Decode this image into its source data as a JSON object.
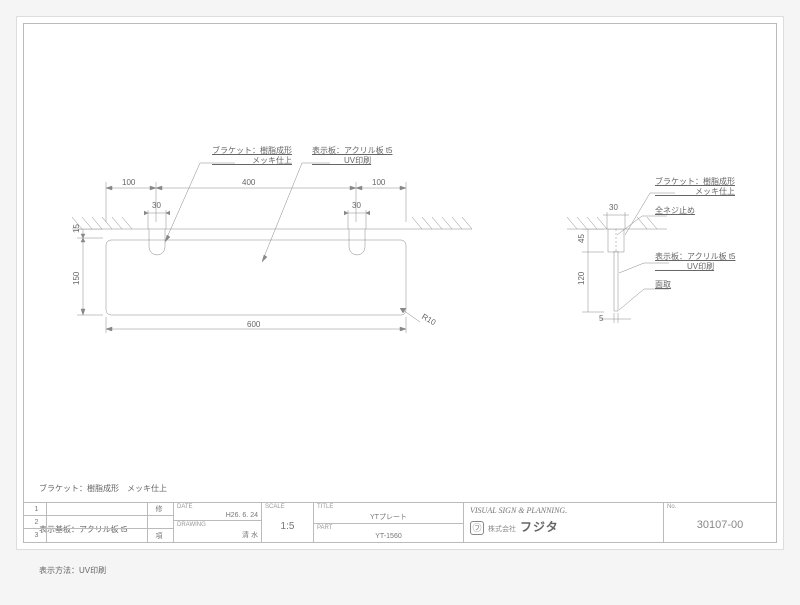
{
  "drawing": {
    "front": {
      "callouts": {
        "bracket": "ブラケット：樹脂成形\n　　　　　メッキ仕上",
        "panel": "表示板：アクリル板 t5\n　　　　UV印刷"
      },
      "dims": {
        "w_total": "600",
        "w_left": "100",
        "w_mid": "400",
        "w_right": "100",
        "bracket_w_left": "30",
        "bracket_w_right": "30",
        "h_total": "150",
        "h_overlap": "15",
        "radius": "R10"
      }
    },
    "side": {
      "callouts": {
        "bracket": "ブラケット：樹脂成形\n　　　　　メッキ仕上",
        "screw": "全ネジ止め",
        "panel": "表示板：アクリル板 t5\n　　　　UV印刷",
        "chamfer": "面取"
      },
      "dims": {
        "bracket_d": "30",
        "bracket_h": "45",
        "panel_h": "120",
        "panel_t": "5"
      }
    },
    "notes": {
      "line1": "ブラケット：樹脂成形　メッキ仕上",
      "line2": "表示基板：アクリル板 t5",
      "line3": "表示方法：UV印刷"
    }
  },
  "title_block": {
    "revisions": [
      "1",
      "2",
      "3"
    ],
    "rev_col2_header": "修",
    "rev_col3_header": "項",
    "date_label": "DATE",
    "date": "H26. 6. 24",
    "drawing_label": "DRAWING",
    "drawer": "清 水",
    "scale_label": "SCALE",
    "scale": "1:5",
    "title_label": "TITLE",
    "title": "YTプレート",
    "part_label": "PART",
    "part": "YT-1560",
    "logo_tag": "VISUAL  SIGN & PLANNING.",
    "company_prefix": "株式会社",
    "company": "フジタ",
    "no_label": "No.",
    "drawing_no": "30107-00"
  }
}
